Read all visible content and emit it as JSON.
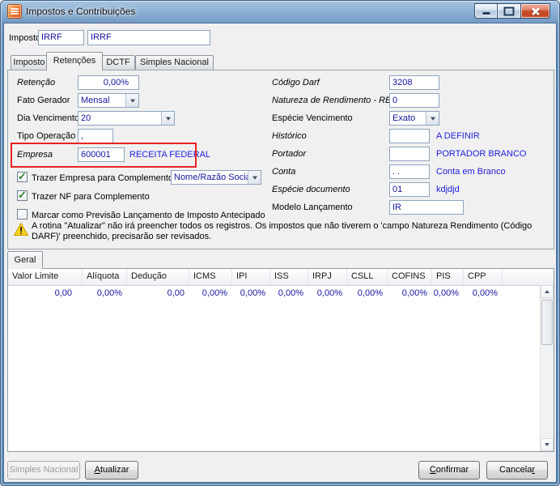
{
  "window": {
    "title": "Impostos e Contribuições"
  },
  "header": {
    "imposto_label": "Imposto",
    "imposto_code": "IRRF",
    "imposto_name": "IRRF"
  },
  "tabs": {
    "imposto": "Imposto",
    "retencoes": "Retenções",
    "dctf": "DCTF",
    "simples_nacional": "Simples Nacional"
  },
  "retencoes": {
    "retencao_label": "Retenção",
    "retencao_value": "0,00%",
    "fato_gerador_label": "Fato Gerador",
    "fato_gerador_value": "Mensal",
    "dia_vencimento_label": "Dia Vencimento",
    "dia_vencimento_value": "20",
    "tipo_operacao_label": "Tipo Operação",
    "tipo_operacao_value": ",",
    "empresa_label": "Empresa",
    "empresa_value": "600001",
    "empresa_desc": "RECEITA FEDERAL",
    "trazer_empresa_label": "Trazer Empresa para Complemento",
    "trazer_empresa_combo": "Nome/Razão Social",
    "trazer_nf_label": "Trazer NF para Complemento",
    "marcar_previsao_label": "Marcar como Previsão Lançamento de Imposto Antecipado",
    "codigo_darf_label": "Código Darf",
    "codigo_darf_value": "3208",
    "natureza_label": "Natureza de Rendimento - REINF",
    "natureza_value": "0",
    "especie_vencimento_label": "Espécie Vencimento",
    "especie_vencimento_value": "Exato",
    "historico_label": "Histórico",
    "historico_value": "",
    "historico_desc": "A DEFINIR",
    "portador_label": "Portador",
    "portador_value": "",
    "portador_desc": "PORTADOR BRANCO",
    "conta_label": "Conta",
    "conta_value": ". .",
    "conta_desc": "Conta em Branco",
    "especie_documento_label": "Espécie documento",
    "especie_documento_value": "01",
    "especie_documento_desc": "kdjdjd",
    "modelo_lancamento_label": "Modelo Lançamento",
    "modelo_lancamento_value": "IR",
    "warning_text": "A rotina \"Atualizar\" não irá preencher todos os registros. Os impostos que não tiverem o 'campo Natureza Rendimento (Código DARF)' preenchido, precisarão ser revisados."
  },
  "geral": {
    "tab_label": "Geral"
  },
  "table": {
    "columns": [
      "Valor Limite",
      "Alíquota",
      "Dedução",
      "ICMS",
      "IPI",
      "ISS",
      "IRPJ",
      "CSLL",
      "COFINS",
      "PIS",
      "CPP"
    ],
    "rows": [
      [
        "0,00",
        "0,00%",
        "0,00",
        "0,00%",
        "0,00%",
        "0,00%",
        "0,00%",
        "0,00%",
        "0,00%",
        "0,00%",
        "0,00%"
      ]
    ]
  },
  "footer": {
    "simples_nacional": "Simples Nacional",
    "atualizar_pre": "",
    "atualizar_key": "A",
    "atualizar_post": "tualizar",
    "confirmar_pre": "",
    "confirmar_key": "C",
    "confirmar_post": "onfirmar",
    "cancelar_pre": "Cancela",
    "cancelar_key": "r",
    "cancelar_post": ""
  },
  "colors": {
    "frame_blue": "#6f97c0",
    "field_value_navy": "#1414a0",
    "description_blue": "#2222dd",
    "annotation_red": "#e8231f",
    "close_button_red": "#cc4f2c",
    "warning_yellow": "#ffd21e"
  }
}
